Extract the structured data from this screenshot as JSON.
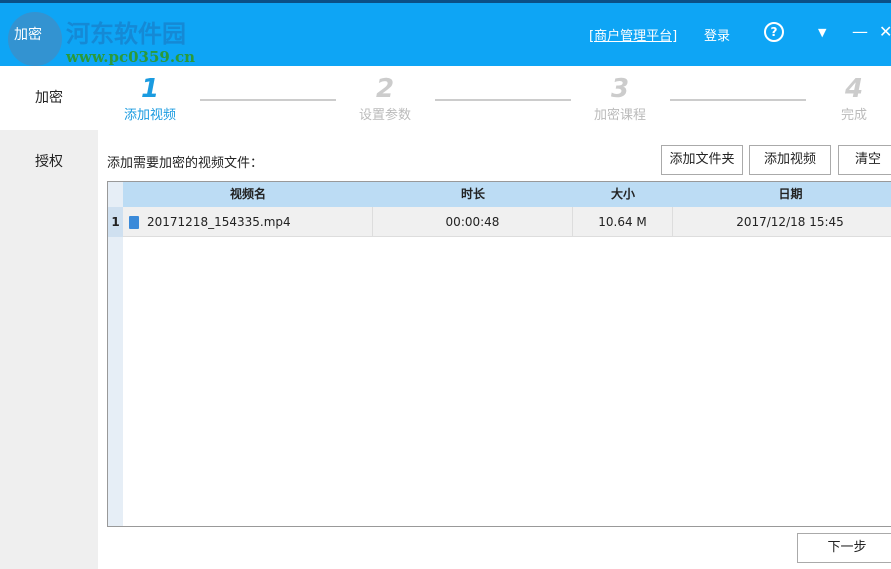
{
  "window": {
    "title": "加密",
    "watermark_cn": "河东软件园",
    "watermark_url": "www.pc0359.cn"
  },
  "titlebar": {
    "merchant_link": "[商户管理平台]",
    "login": "登录",
    "help": "?",
    "menu": "▼",
    "minimize": "—",
    "close": "✕"
  },
  "sidebar": {
    "items": [
      {
        "label": "加密"
      },
      {
        "label": "授权"
      }
    ]
  },
  "steps": [
    {
      "num": "1",
      "label": "添加视频"
    },
    {
      "num": "2",
      "label": "设置参数"
    },
    {
      "num": "3",
      "label": "加密课程"
    },
    {
      "num": "4",
      "label": "完成"
    }
  ],
  "main": {
    "hint": "添加需要加密的视频文件：",
    "add_folder": "添加文件夹",
    "add_video": "添加视频",
    "clear": "清空",
    "next": "下一步"
  },
  "table": {
    "headers": [
      "视频名",
      "时长",
      "大小",
      "日期"
    ],
    "rows": [
      {
        "index": "1",
        "name": "20171218_154335.mp4",
        "duration": "00:00:48",
        "size": "10.64 M",
        "date": "2017/12/18 15:45"
      }
    ]
  }
}
